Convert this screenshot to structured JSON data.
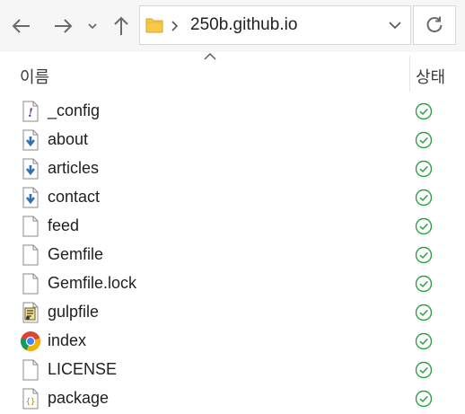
{
  "nav": {
    "back_icon": "arrow-left-icon",
    "forward_icon": "arrow-right-icon",
    "recent_icon": "chevron-down-icon",
    "up_icon": "arrow-up-icon",
    "refresh_icon": "refresh-icon"
  },
  "address": {
    "path": "250b.github.io",
    "folder_color": "#f7c948"
  },
  "columns": {
    "name": "이름",
    "status": "상태"
  },
  "files": [
    {
      "name": "_config",
      "icon": "config-file-icon"
    },
    {
      "name": "about",
      "icon": "markdown-file-icon"
    },
    {
      "name": "articles",
      "icon": "markdown-file-icon"
    },
    {
      "name": "contact",
      "icon": "markdown-file-icon"
    },
    {
      "name": "feed",
      "icon": "blank-file-icon"
    },
    {
      "name": "Gemfile",
      "icon": "blank-file-icon"
    },
    {
      "name": "Gemfile.lock",
      "icon": "blank-file-icon"
    },
    {
      "name": "gulpfile",
      "icon": "script-file-icon"
    },
    {
      "name": "index",
      "icon": "chrome-icon"
    },
    {
      "name": "LICENSE",
      "icon": "blank-file-icon"
    },
    {
      "name": "package",
      "icon": "json-file-icon"
    }
  ],
  "status_color": "#2e9e4a"
}
